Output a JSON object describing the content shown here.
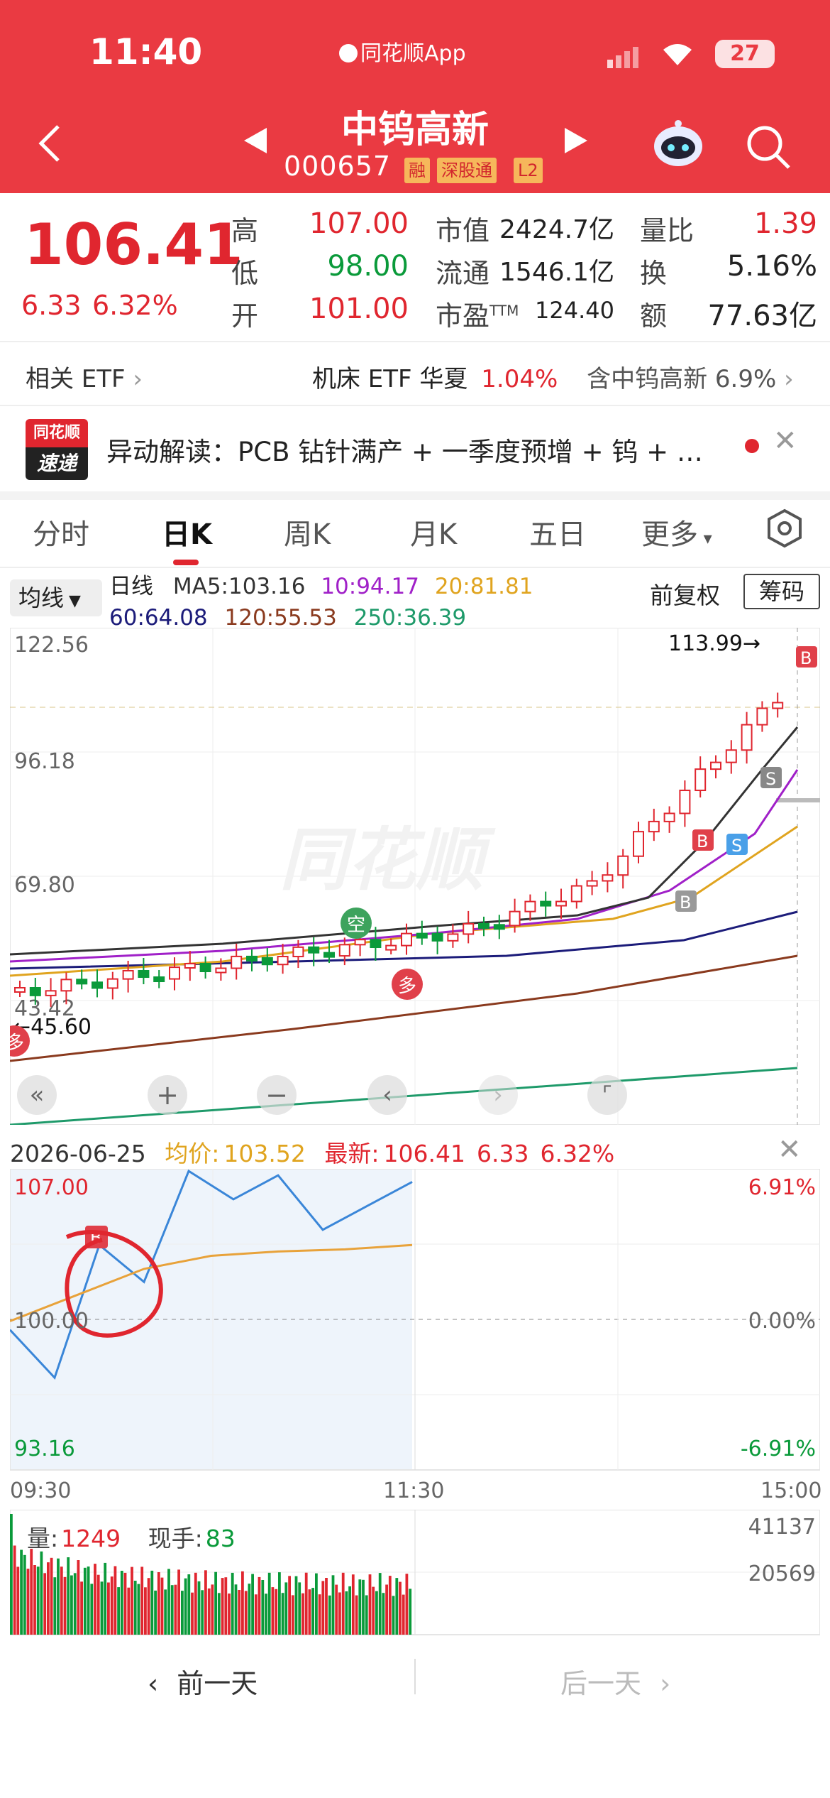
{
  "status_bar": {
    "time": "11:40",
    "app_name": "同花顺App",
    "battery": "27"
  },
  "header": {
    "stock_name": "中钨高新",
    "stock_code": "000657",
    "tags": [
      "融",
      "深股通",
      "L2"
    ]
  },
  "quote": {
    "price": "106.41",
    "change": "6.33",
    "change_pct": "6.32%",
    "high_label": "高",
    "high": "107.00",
    "low_label": "低",
    "low": "98.00",
    "open_label": "开",
    "open": "101.00",
    "mcap_label": "市值",
    "mcap": "2424.7亿",
    "float_label": "流通",
    "float": "1546.1亿",
    "pe_label": "市盈",
    "pe_sup": "TTM",
    "pe": "124.40",
    "vol_ratio_label": "量比",
    "vol_ratio": "1.39",
    "turnover_label": "换",
    "turnover": "5.16%",
    "amount_label": "额",
    "amount": "77.63亿"
  },
  "etf": {
    "label": "相关 ETF",
    "name": "机床 ETF 华夏",
    "pct": "1.04%",
    "holding": "含中钨高新 6.9%"
  },
  "news": {
    "badge_line1": "同花顺",
    "badge_line2": "速递",
    "text": "异动解读：PCB 钻针满产 + 一季度预增 + 钨 + …"
  },
  "tabs": [
    "分时",
    "日K",
    "周K",
    "月K",
    "五日",
    "更多"
  ],
  "kline": {
    "indicator_select": "均线",
    "line_label": "日线",
    "ma": [
      {
        "label": "MA5:103.16",
        "color": "#333333"
      },
      {
        "label": "10:94.17",
        "color": "#a020c8"
      },
      {
        "label": "20:81.81",
        "color": "#e0a41f"
      },
      {
        "label": "60:64.08",
        "color": "#1c1c7a"
      },
      {
        "label": "120:55.53",
        "color": "#8a3a1e"
      },
      {
        "label": "250:36.39",
        "color": "#1e9a6a"
      }
    ],
    "adjust": "前复权",
    "chip_button": "筹码",
    "y_ticks": [
      "122.56",
      "96.18",
      "69.80",
      "43.42"
    ],
    "max_label": "113.99→",
    "min_label": "←45.60",
    "markers": {
      "kong": "空",
      "duo": "多",
      "B": "B",
      "S": "S"
    },
    "watermark": "同花顺"
  },
  "intraday": {
    "date": "2026-06-25",
    "avg_label": "均价:",
    "avg": "103.52",
    "latest_label": "最新:",
    "latest": "106.41",
    "change": "6.33",
    "change_pct": "6.32%",
    "y_top": "107.00",
    "y_mid": "100.00",
    "y_bottom": "93.16",
    "pct_top": "6.91%",
    "pct_mid": "0.00%",
    "pct_bottom": "-6.91%",
    "times": [
      "09:30",
      "11:30",
      "15:00"
    ],
    "vol_label": "量:",
    "vol": "1249",
    "now_label": "现手:",
    "now": "83",
    "vol_ticks": [
      "41137",
      "20569"
    ]
  },
  "footer": {
    "prev": "前一天",
    "next": "后一天"
  },
  "chart_data": {
    "type": "line",
    "title": "",
    "x": [
      "09:30",
      "11:30",
      "15:00"
    ],
    "series": [
      {
        "name": "",
        "values": [
          99.6,
          97.4,
          103.5,
          101.8,
          106.9,
          105.6,
          106.7,
          104.2,
          105.3,
          106.4
        ]
      },
      {
        "name": "均价",
        "values": [
          100.0,
          101.2,
          102.4,
          103.0,
          103.2,
          103.3,
          103.5
        ]
      }
    ],
    "ylim": [
      93.16,
      107.0
    ],
    "grid": true
  }
}
